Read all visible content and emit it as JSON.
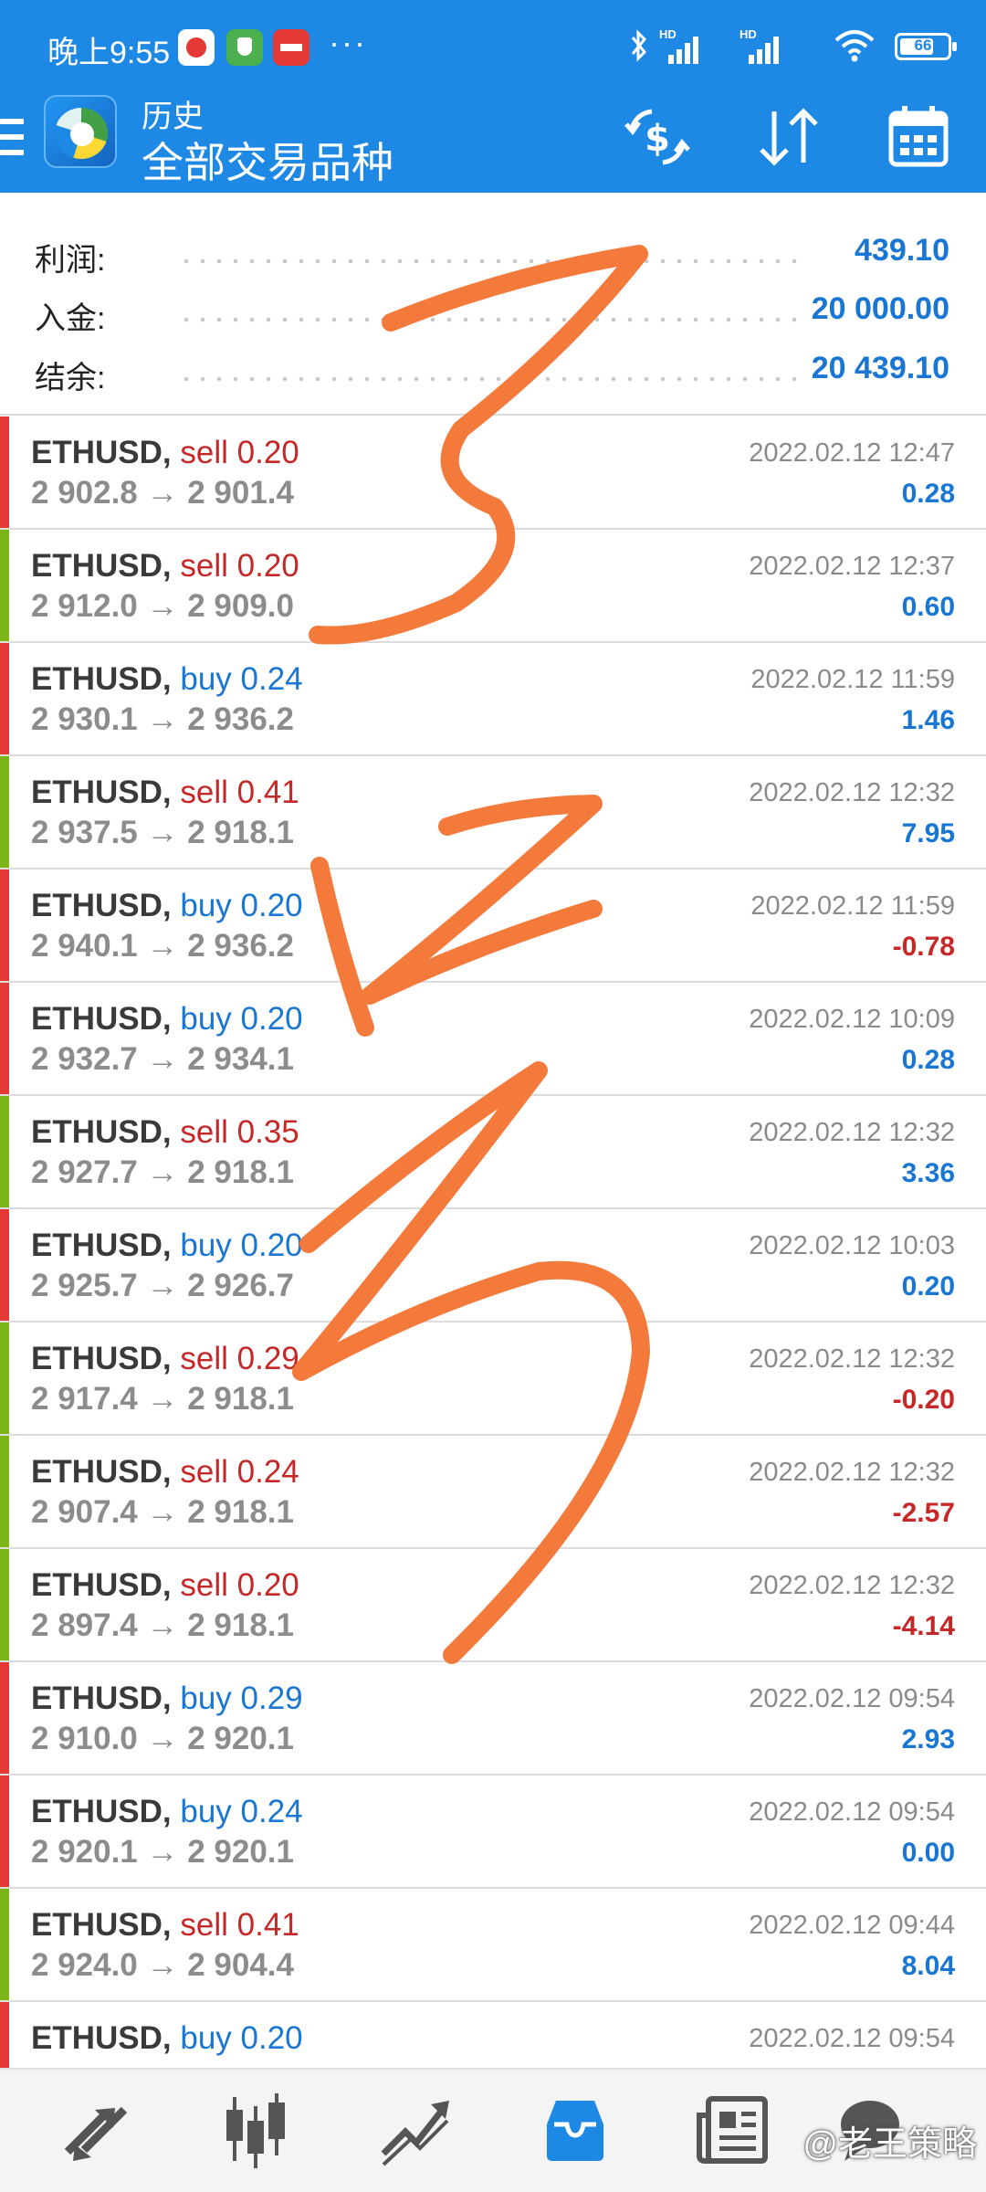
{
  "status_bar": {
    "time": "晚上9:55",
    "more": "···",
    "battery_level": "66",
    "network_badges": [
      "HD",
      "HD"
    ]
  },
  "app_bar": {
    "subtitle": "历史",
    "title": "全部交易品种",
    "actions": [
      "currency-exchange-icon",
      "sort-icon",
      "calendar-icon"
    ]
  },
  "summary": {
    "rows": [
      {
        "label": "利润:",
        "value": "439.10"
      },
      {
        "label": "入金:",
        "value": "20 000.00"
      },
      {
        "label": "结余:",
        "value": "20 439.10"
      }
    ]
  },
  "colors": {
    "primary": "#1e88e5",
    "sell": "#c62828",
    "buy": "#1976d2",
    "profit_positive": "#1976d2",
    "profit_negative": "#c62828",
    "edge_red": "#e53935",
    "edge_green": "#7cb518",
    "annotation": "#f47a3c"
  },
  "deals": [
    {
      "symbol": "ETHUSD,",
      "side": "sell",
      "volume": "0.20",
      "prices": "2 902.8 → 2 901.4",
      "time": "2022.02.12 12:47",
      "profit": "0.28",
      "edge": "red"
    },
    {
      "symbol": "ETHUSD,",
      "side": "sell",
      "volume": "0.20",
      "prices": "2 912.0 → 2 909.0",
      "time": "2022.02.12 12:37",
      "profit": "0.60",
      "edge": "green"
    },
    {
      "symbol": "ETHUSD,",
      "side": "buy",
      "volume": "0.24",
      "prices": "2 930.1 → 2 936.2",
      "time": "2022.02.12 11:59",
      "profit": "1.46",
      "edge": "red"
    },
    {
      "symbol": "ETHUSD,",
      "side": "sell",
      "volume": "0.41",
      "prices": "2 937.5 → 2 918.1",
      "time": "2022.02.12 12:32",
      "profit": "7.95",
      "edge": "green"
    },
    {
      "symbol": "ETHUSD,",
      "side": "buy",
      "volume": "0.20",
      "prices": "2 940.1 → 2 936.2",
      "time": "2022.02.12 11:59",
      "profit": "-0.78",
      "edge": "red"
    },
    {
      "symbol": "ETHUSD,",
      "side": "buy",
      "volume": "0.20",
      "prices": "2 932.7 → 2 934.1",
      "time": "2022.02.12 10:09",
      "profit": "0.28",
      "edge": "red"
    },
    {
      "symbol": "ETHUSD,",
      "side": "sell",
      "volume": "0.35",
      "prices": "2 927.7 → 2 918.1",
      "time": "2022.02.12 12:32",
      "profit": "3.36",
      "edge": "green"
    },
    {
      "symbol": "ETHUSD,",
      "side": "buy",
      "volume": "0.20",
      "prices": "2 925.7 → 2 926.7",
      "time": "2022.02.12 10:03",
      "profit": "0.20",
      "edge": "red"
    },
    {
      "symbol": "ETHUSD,",
      "side": "sell",
      "volume": "0.29",
      "prices": "2 917.4 → 2 918.1",
      "time": "2022.02.12 12:32",
      "profit": "-0.20",
      "edge": "green"
    },
    {
      "symbol": "ETHUSD,",
      "side": "sell",
      "volume": "0.24",
      "prices": "2 907.4 → 2 918.1",
      "time": "2022.02.12 12:32",
      "profit": "-2.57",
      "edge": "green"
    },
    {
      "symbol": "ETHUSD,",
      "side": "sell",
      "volume": "0.20",
      "prices": "2 897.4 → 2 918.1",
      "time": "2022.02.12 12:32",
      "profit": "-4.14",
      "edge": "green"
    },
    {
      "symbol": "ETHUSD,",
      "side": "buy",
      "volume": "0.29",
      "prices": "2 910.0 → 2 920.1",
      "time": "2022.02.12 09:54",
      "profit": "2.93",
      "edge": "red"
    },
    {
      "symbol": "ETHUSD,",
      "side": "buy",
      "volume": "0.24",
      "prices": "2 920.1 → 2 920.1",
      "time": "2022.02.12 09:54",
      "profit": "0.00",
      "edge": "red"
    },
    {
      "symbol": "ETHUSD,",
      "side": "sell",
      "volume": "0.41",
      "prices": "2 924.0 → 2 904.4",
      "time": "2022.02.12 09:44",
      "profit": "8.04",
      "edge": "green"
    },
    {
      "symbol": "ETHUSD,",
      "side": "buy",
      "volume": "0.20",
      "prices": "",
      "time": "2022.02.12 09:54",
      "profit": "",
      "edge": "red"
    }
  ],
  "bottom_nav": {
    "items": [
      "quotes-icon",
      "chart-icon",
      "trade-icon",
      "history-icon",
      "news-icon",
      "messages-icon"
    ],
    "active": "history-icon"
  },
  "watermark": "@老王策略"
}
